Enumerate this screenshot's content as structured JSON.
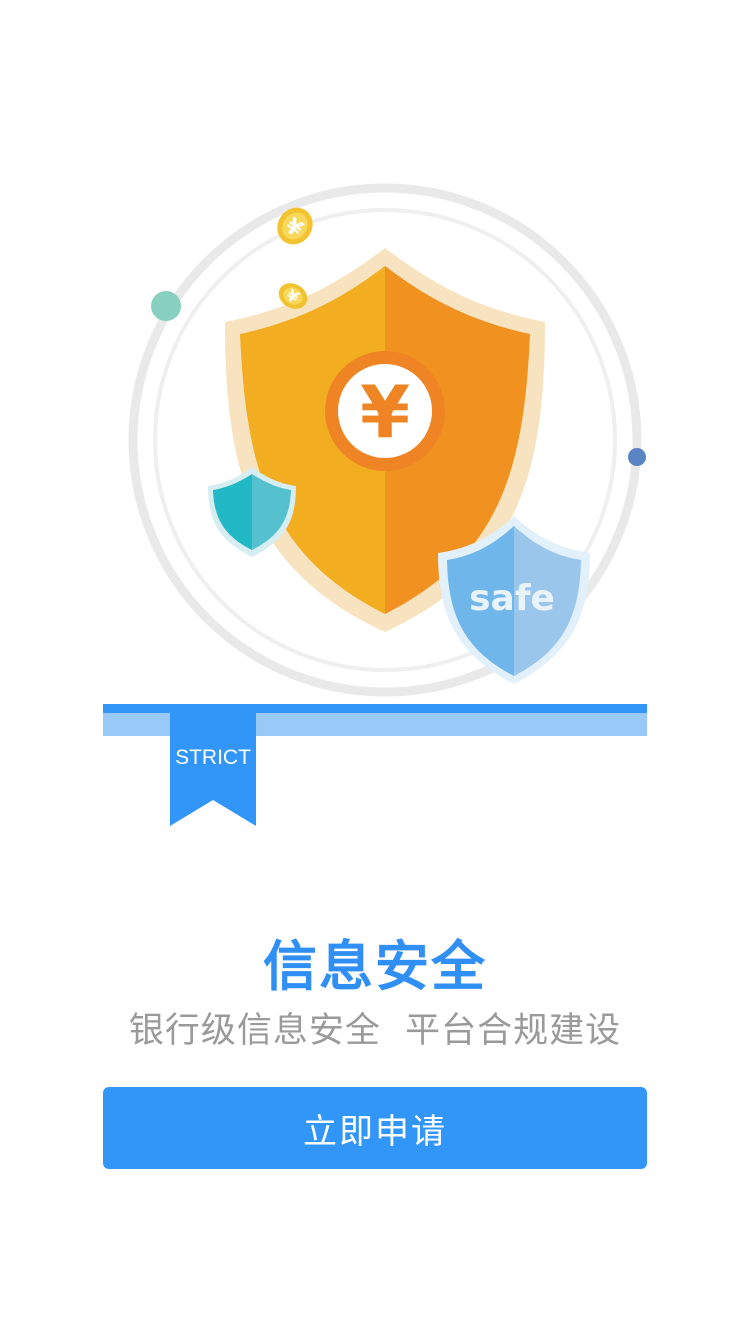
{
  "illustration": {
    "shield_symbol": "¥",
    "coin_symbol": "¥",
    "safe_label": "safe",
    "ribbon_label": "STRICT",
    "colors": {
      "shield_left": "#f2ad20",
      "shield_right": "#f09120",
      "small_shield_teal": "#22b8c6",
      "safe_shield_blue": "#6fb6ea",
      "ribbon_blue": "#3296f9",
      "bar_light_blue": "#99c9f7",
      "ring_gray": "#e8e8e8",
      "dot_green": "#88d0c0",
      "dot_blue": "#5b84c4"
    }
  },
  "content": {
    "title": "信息安全",
    "subtitle": "银行级信息安全  平台合规建设"
  },
  "actions": {
    "apply_label": "立即申请"
  },
  "theme": {
    "accent": "#3296f9",
    "title_color": "#2f8ff5",
    "subtitle_color": "#9a9a9a"
  }
}
